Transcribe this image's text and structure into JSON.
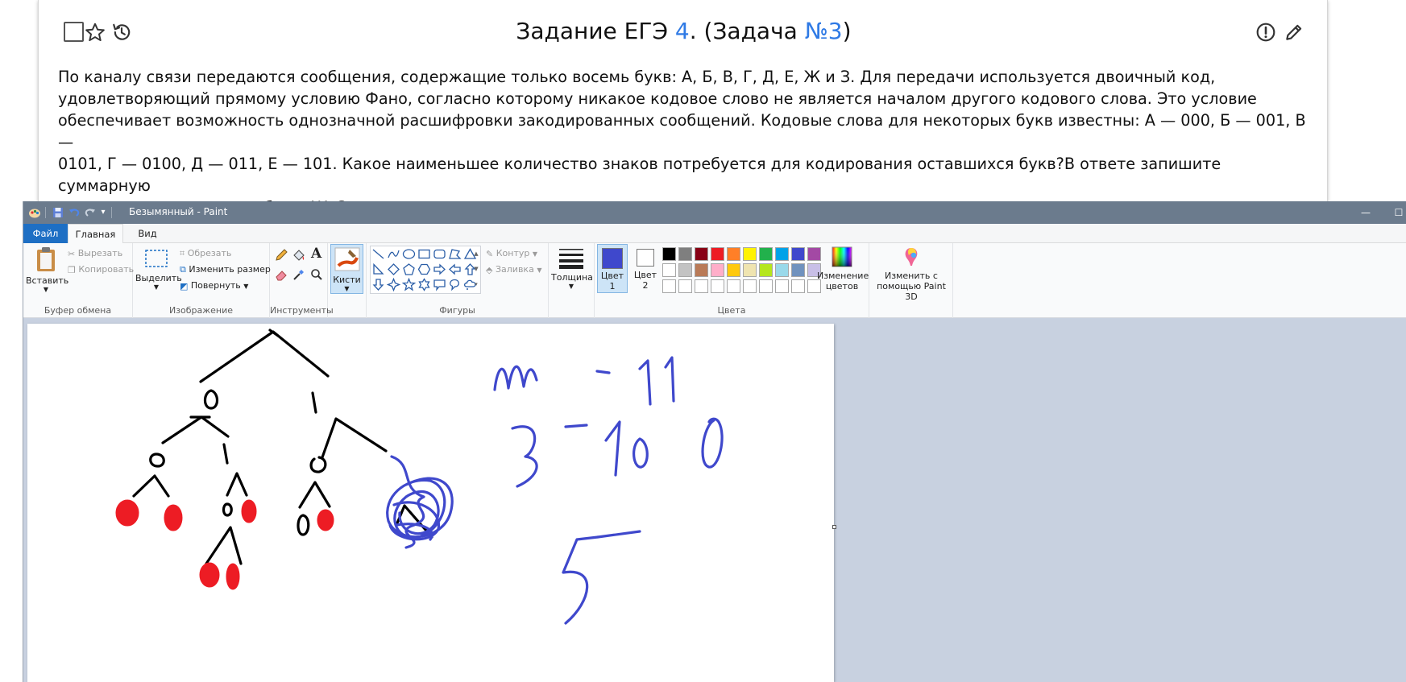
{
  "task": {
    "title_prefix": "Задание ЕГЭ ",
    "exam_number": "4",
    "title_middle": ". (Задача ",
    "problem_number": "№3",
    "title_suffix": ")",
    "text": "По каналу связи передаются сообщения, содержащие только восемь букв: А, Б, В, Г, Д, Е, Ж и З. Для передачи используется двоичный код,\nудовлетворяющий прямому условию Фано, согласно которому никакое кодовое слово не является началом другого кодового слова. Это условие\nобеспечивает возможность однозначной расшифровки закодированных сообщений. Кодовые слова для некоторых букв известны: А  — 000, Б  — 001, В  —\n0101, Г  — 0100, Д  — 011, Е  — 101. Какое наименьшее количество знаков потребуется для кодирования оставшихся букв?В ответе запишите суммарную\nдлину кодовых слов для букв: Ж, З."
  },
  "paint": {
    "window_title": "Безымянный - Paint",
    "tabs": {
      "file": "Файл",
      "home": "Главная",
      "view": "Вид"
    },
    "clipboard": {
      "paste": "Вставить",
      "cut": "Вырезать",
      "copy": "Копировать",
      "group": "Буфер обмена"
    },
    "image": {
      "select": "Выделить",
      "crop": "Обрезать",
      "resize": "Изменить размер",
      "rotate": "Повернуть",
      "group": "Изображение"
    },
    "tools": {
      "group": "Инструменты"
    },
    "brushes": {
      "label": "Кисти"
    },
    "shapes": {
      "outline": "Контур",
      "fill": "Заливка",
      "group": "Фигуры"
    },
    "size": {
      "label": "Толщина"
    },
    "colors": {
      "color1_label": "Цвет",
      "color1_num": "1",
      "color2_label": "Цвет",
      "color2_num": "2",
      "color1": "#3f48cc",
      "color2": "#ffffff",
      "edit_line1": "Изменение",
      "edit_line2": "цветов",
      "group": "Цвета",
      "palette_row1": [
        "#000000",
        "#7f7f7f",
        "#880015",
        "#ed1c24",
        "#ff7f27",
        "#fff200",
        "#22b14c",
        "#00a2e8",
        "#3f48cc",
        "#a349a4"
      ],
      "palette_row2": [
        "#ffffff",
        "#c3c3c3",
        "#b97a57",
        "#ffaec9",
        "#ffc90e",
        "#efe4b0",
        "#b5e61d",
        "#99d9ea",
        "#7092be",
        "#c8bfe7"
      ]
    },
    "paint3d": {
      "line1": "Изменить с",
      "line2": "помощью Paint 3D"
    },
    "drawing": {
      "ink_black": "#000000",
      "ink_red": "#ed1c24",
      "ink_blue": "#3f48cc"
    }
  }
}
